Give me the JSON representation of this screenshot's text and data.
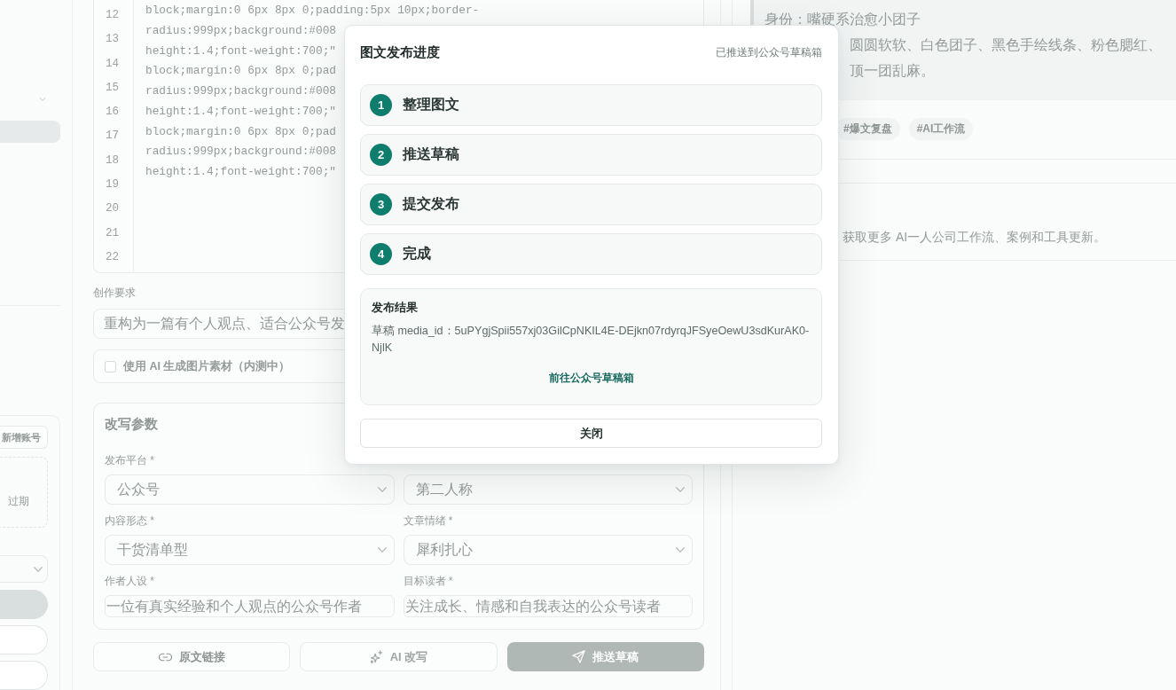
{
  "sidebar": {
    "group_expanded": true,
    "menu_items": [
      {
        "selected": true
      }
    ],
    "account_button": "新增账号",
    "account_notice": "过期",
    "pills": [
      {
        "selected": true
      },
      {
        "selected": false
      },
      {
        "selected": false
      }
    ]
  },
  "editor": {
    "line_numbers": [
      "12",
      "13",
      "14",
      "15",
      "16",
      "17",
      "18",
      "19",
      "20",
      "21",
      "22"
    ],
    "code_lines": [
      "block;margin:0 6px 8px 0;padding:5px 10px;border-",
      "radius:999px;background:#008",
      "height:1.4;font-weight:700;\"",
      "block;margin:0 6px 8px 0;pad",
      "radius:999px;background:#008",
      "height:1.4;font-weight:700;\"",
      "block;margin:0 6px 8px 0;pad",
      "radius:999px;background:#008",
      "height:1.4;font-weight:700;\""
    ]
  },
  "requirement": {
    "label": "创作要求",
    "value": "重构为一篇有个人观点、适合公众号发"
  },
  "ai_images": {
    "label": "使用 AI 生成图片素材（内测中）",
    "checked": false
  },
  "params": {
    "title": "改写参数",
    "fields": [
      {
        "kind": "select",
        "label": "发布平台 *",
        "value": "公众号"
      },
      {
        "kind": "select",
        "value": "第二人称"
      },
      {
        "kind": "select",
        "label": "内容形态 *",
        "value": "干货清单型"
      },
      {
        "kind": "select",
        "label": "文章情绪 *",
        "value": "犀利扎心"
      },
      {
        "kind": "input",
        "label": "作者人设 *",
        "value": "一位有真实经验和个人观点的公众号作者"
      },
      {
        "kind": "input",
        "label": "目标读者 *",
        "value": "关注成长、情感和自我表达的公众号读者"
      }
    ]
  },
  "actions": [
    {
      "kind": "link",
      "label": "原文链接",
      "disabled": false
    },
    {
      "kind": "rewrite",
      "label": "AI 改写",
      "disabled": true
    },
    {
      "kind": "push",
      "label": "推送草稿",
      "disabled": true
    }
  ],
  "preview": {
    "profile_lines": [
      "身份：嘴硬系治愈小团子",
      "圆圆软软、白色团子、黑色手绘线条、粉色腮红、",
      "顶一团乱麻。"
    ],
    "tags": [
      "#爆文复盘",
      "#AI工作流"
    ],
    "follow_text": "获取更多 AI一人公司工作流、案例和工具更新。"
  },
  "dialog": {
    "title": "图文发布进度",
    "status": "已推送到公众号草稿箱",
    "steps": [
      {
        "number": "1",
        "label": "整理图文",
        "done": true
      },
      {
        "number": "2",
        "label": "推送草稿",
        "done": true
      },
      {
        "number": "3",
        "label": "提交发布",
        "done": true
      },
      {
        "number": "4",
        "label": "完成",
        "done": true
      }
    ],
    "result": {
      "title": "发布结果",
      "text": "草稿 media_id：5uPYgjSpii557xj03GilCpNKIL4E-DEjkn07rdyrqJFSyeOewU3sdKurAK0-NjlK",
      "link": "前往公众号草稿箱"
    },
    "close_button": "关闭"
  }
}
